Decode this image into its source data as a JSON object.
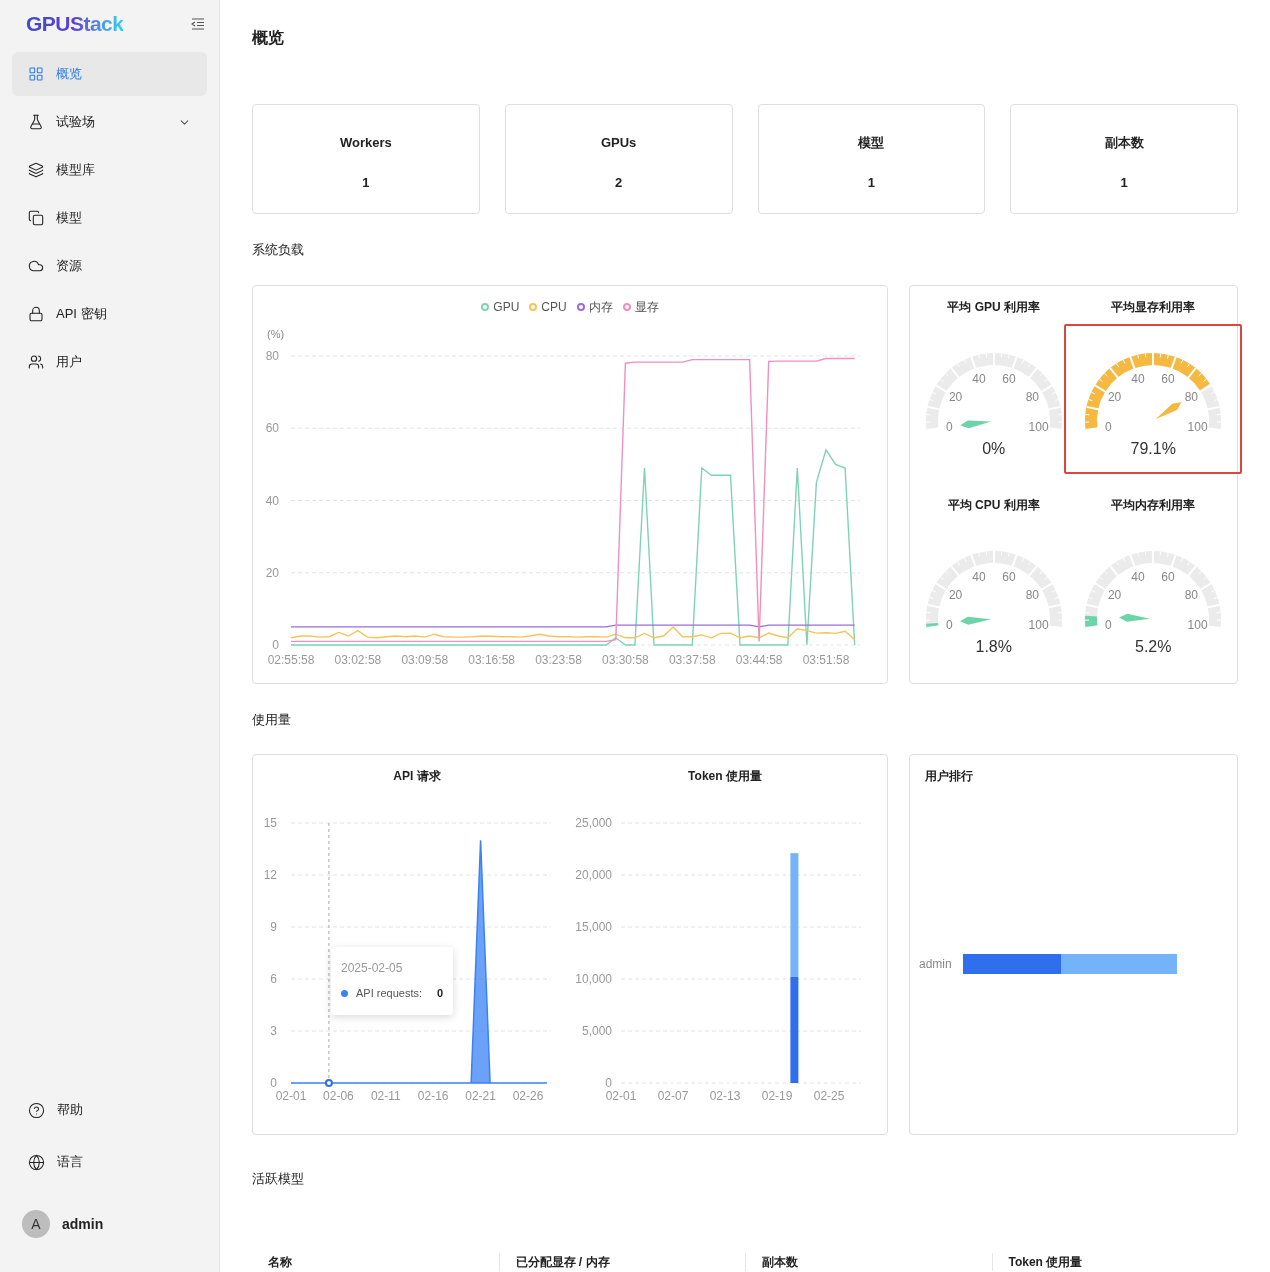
{
  "sidebar": {
    "logo": "GPUStack",
    "items": [
      {
        "label": "概览",
        "selected": true
      },
      {
        "label": "试验场",
        "selected": false,
        "expandable": true
      },
      {
        "label": "模型库",
        "selected": false
      },
      {
        "label": "模型",
        "selected": false
      },
      {
        "label": "资源",
        "selected": false
      },
      {
        "label": "API 密钥",
        "selected": false
      },
      {
        "label": "用户",
        "selected": false
      }
    ],
    "footer_items": [
      {
        "label": "帮助"
      },
      {
        "label": "语言"
      }
    ],
    "user": {
      "avatar": "A",
      "name": "admin"
    }
  },
  "page_title": "概览",
  "stats": [
    {
      "label": "Workers",
      "value": "1"
    },
    {
      "label": "GPUs",
      "value": "2"
    },
    {
      "label": "模型",
      "value": "1"
    },
    {
      "label": "副本数",
      "value": "1"
    }
  ],
  "system_load": {
    "title": "系统负载",
    "chart_data": {
      "type": "line",
      "ylabel": "(%)",
      "legend": "top",
      "ylim": [
        0,
        80
      ],
      "yticks": [
        0,
        20,
        40,
        60,
        80
      ],
      "grid": true,
      "categories": [
        "02:55:58",
        null,
        null,
        null,
        null,
        null,
        null,
        "03:02:58",
        null,
        null,
        null,
        null,
        null,
        null,
        "03:09:58",
        null,
        null,
        null,
        null,
        null,
        null,
        "03:16:58",
        null,
        null,
        null,
        null,
        null,
        null,
        "03:23:58",
        null,
        null,
        null,
        null,
        null,
        null,
        "03:30:58",
        null,
        null,
        null,
        null,
        null,
        null,
        "03:37:58",
        null,
        null,
        null,
        null,
        null,
        null,
        "03:44:58",
        null,
        null,
        null,
        null,
        null,
        null,
        "03:51:58",
        null,
        null,
        null
      ],
      "series": [
        {
          "name": "GPU",
          "color": "#7fd3b4",
          "values": [
            0,
            0,
            0,
            0,
            0,
            0,
            0,
            0,
            0,
            0,
            0,
            0,
            0,
            0,
            0,
            0,
            0,
            0,
            0,
            0,
            0,
            0,
            0,
            0,
            0,
            0,
            0,
            0,
            0,
            0,
            0,
            0,
            0,
            0,
            2,
            0,
            0,
            49,
            0,
            0,
            0,
            0,
            0,
            49,
            47,
            47,
            47,
            0,
            0,
            0,
            0,
            0,
            0,
            49,
            0,
            45,
            54,
            50,
            49,
            0
          ]
        },
        {
          "name": "CPU",
          "color": "#f2c55c",
          "values": [
            2,
            2.5,
            2.5,
            2.2,
            2.3,
            3.5,
            2.5,
            4,
            2.2,
            2,
            2.3,
            2.5,
            2.3,
            2.5,
            2.2,
            3,
            2.3,
            2.2,
            2.2,
            2.3,
            2.5,
            2.4,
            2.3,
            2.3,
            2.2,
            2.5,
            3,
            2.5,
            2.3,
            2.3,
            2.2,
            2.3,
            2.3,
            2.2,
            3,
            2,
            2,
            3.2,
            2,
            2.5,
            5,
            2.3,
            2.3,
            2.8,
            2,
            3.2,
            3.3,
            2,
            2.5,
            2,
            3.3,
            2.5,
            2,
            4.5,
            4,
            3.3,
            3.4,
            3.2,
            3.8,
            1.5
          ]
        },
        {
          "name": "内存",
          "color": "#9a6dd7",
          "values": [
            5,
            5,
            5,
            5,
            5,
            5,
            5,
            5,
            5,
            5,
            5,
            5,
            5,
            5,
            5,
            5,
            5,
            5,
            5,
            5,
            5,
            5,
            5,
            5,
            5,
            5,
            5,
            5,
            5,
            5,
            5,
            5,
            5,
            5,
            5.5,
            5.5,
            5.5,
            5.5,
            5.5,
            5.5,
            5.5,
            5.5,
            5.5,
            5.5,
            5.5,
            5.5,
            5.5,
            5.5,
            5.5,
            5,
            5.5,
            5.5,
            5.5,
            5.5,
            5.5,
            5.5,
            5.5,
            5.5,
            5.5,
            5.5
          ]
        },
        {
          "name": "显存",
          "color": "#f08fc0",
          "values": [
            1,
            1,
            1,
            1,
            1,
            1,
            1,
            1,
            1,
            1,
            1,
            1,
            1,
            1,
            1,
            1,
            1,
            1,
            1,
            1,
            1,
            1,
            1,
            1,
            1,
            1,
            1,
            1,
            1,
            1,
            1,
            1,
            1,
            1,
            1.5,
            78,
            78.3,
            78.3,
            78.3,
            78.3,
            78.3,
            78.3,
            79,
            79,
            79,
            79,
            79,
            79,
            79,
            1,
            78.5,
            78.6,
            78.6,
            78.6,
            78.6,
            78.6,
            79.3,
            79.3,
            79.3,
            79.3
          ]
        }
      ]
    },
    "gauges": [
      {
        "title": "平均 GPU 利用率",
        "level": 0,
        "reading": "0%",
        "color": "#6dd3a8",
        "highlighted": false,
        "scale": [
          "0",
          "20",
          "40",
          "60",
          "80",
          "100"
        ]
      },
      {
        "title": "平均显存利用率",
        "level": 0.791,
        "reading": "79.1%",
        "color": "#f5b942",
        "highlighted": true,
        "scale": [
          "0",
          "20",
          "40",
          "60",
          "80",
          "100"
        ]
      },
      {
        "title": "平均 CPU 利用率",
        "level": 0.018,
        "reading": "1.8%",
        "color": "#6dd3a8",
        "highlighted": false,
        "scale": [
          "0",
          "20",
          "40",
          "60",
          "80",
          "100"
        ]
      },
      {
        "title": "平均内存利用率",
        "level": 0.052,
        "reading": "5.2%",
        "color": "#6dd3a8",
        "highlighted": false,
        "scale": [
          "0",
          "20",
          "40",
          "60",
          "80",
          "100"
        ]
      }
    ]
  },
  "usage": {
    "title": "使用量",
    "api_requests": {
      "chart_data": {
        "type": "area",
        "title": "API 请求",
        "ylim": [
          0,
          15
        ],
        "yticks": [
          0,
          3,
          6,
          9,
          12,
          15
        ],
        "grid": true,
        "categories": [
          "02-01",
          null,
          null,
          null,
          null,
          "02-06",
          null,
          null,
          null,
          null,
          "02-11",
          null,
          null,
          null,
          null,
          "02-16",
          null,
          null,
          null,
          null,
          "02-21",
          null,
          null,
          null,
          null,
          "02-26",
          null,
          null
        ],
        "series": [
          {
            "color": "#3b82f6",
            "values": [
              0,
              0,
              0,
              0,
              0,
              0,
              0,
              0,
              0,
              0,
              0,
              0,
              0,
              0,
              0,
              0,
              0,
              0,
              0,
              0,
              14,
              0,
              0,
              0,
              0,
              0,
              0,
              0
            ]
          }
        ]
      },
      "tooltip": {
        "date": "2025-02-05",
        "label": "API requests:",
        "value": "0"
      }
    },
    "token_usage": {
      "chart_data": {
        "type": "bar",
        "title": "Token 使用量",
        "stacked": true,
        "ylim": [
          0,
          25000
        ],
        "grid": true,
        "yticks": [
          {
            "value": 0,
            "label": "0"
          },
          {
            "value": 5000,
            "label": "5,000"
          },
          {
            "value": 10000,
            "label": "10,000"
          },
          {
            "value": 15000,
            "label": "15,000"
          },
          {
            "value": 20000,
            "label": "20,000"
          },
          {
            "value": 25000,
            "label": "25,000"
          }
        ],
        "categories": [
          "02-01",
          null,
          null,
          null,
          null,
          null,
          "02-07",
          null,
          null,
          null,
          null,
          null,
          "02-13",
          null,
          null,
          null,
          null,
          null,
          "02-19",
          null,
          null,
          null,
          null,
          null,
          "02-25",
          null,
          null,
          null
        ],
        "series": [
          {
            "color": "#2f6fed",
            "values": [
              0,
              0,
              0,
              0,
              0,
              0,
              0,
              0,
              0,
              0,
              0,
              0,
              0,
              0,
              0,
              0,
              0,
              0,
              0,
              0,
              10200,
              0,
              0,
              0,
              0,
              0,
              0,
              0
            ]
          },
          {
            "color": "#74b3f7",
            "values": [
              0,
              0,
              0,
              0,
              0,
              0,
              0,
              0,
              0,
              0,
              0,
              0,
              0,
              0,
              0,
              0,
              0,
              0,
              0,
              0,
              11900,
              0,
              0,
              0,
              0,
              0,
              0,
              0
            ]
          }
        ]
      }
    },
    "user_ranking": {
      "title": "用户排行",
      "users": [
        "admin"
      ]
    }
  },
  "active_models": {
    "title": "活跃模型",
    "columns": [
      "名称",
      "已分配显存 / 内存",
      "副本数",
      "Token 使用量"
    ]
  }
}
